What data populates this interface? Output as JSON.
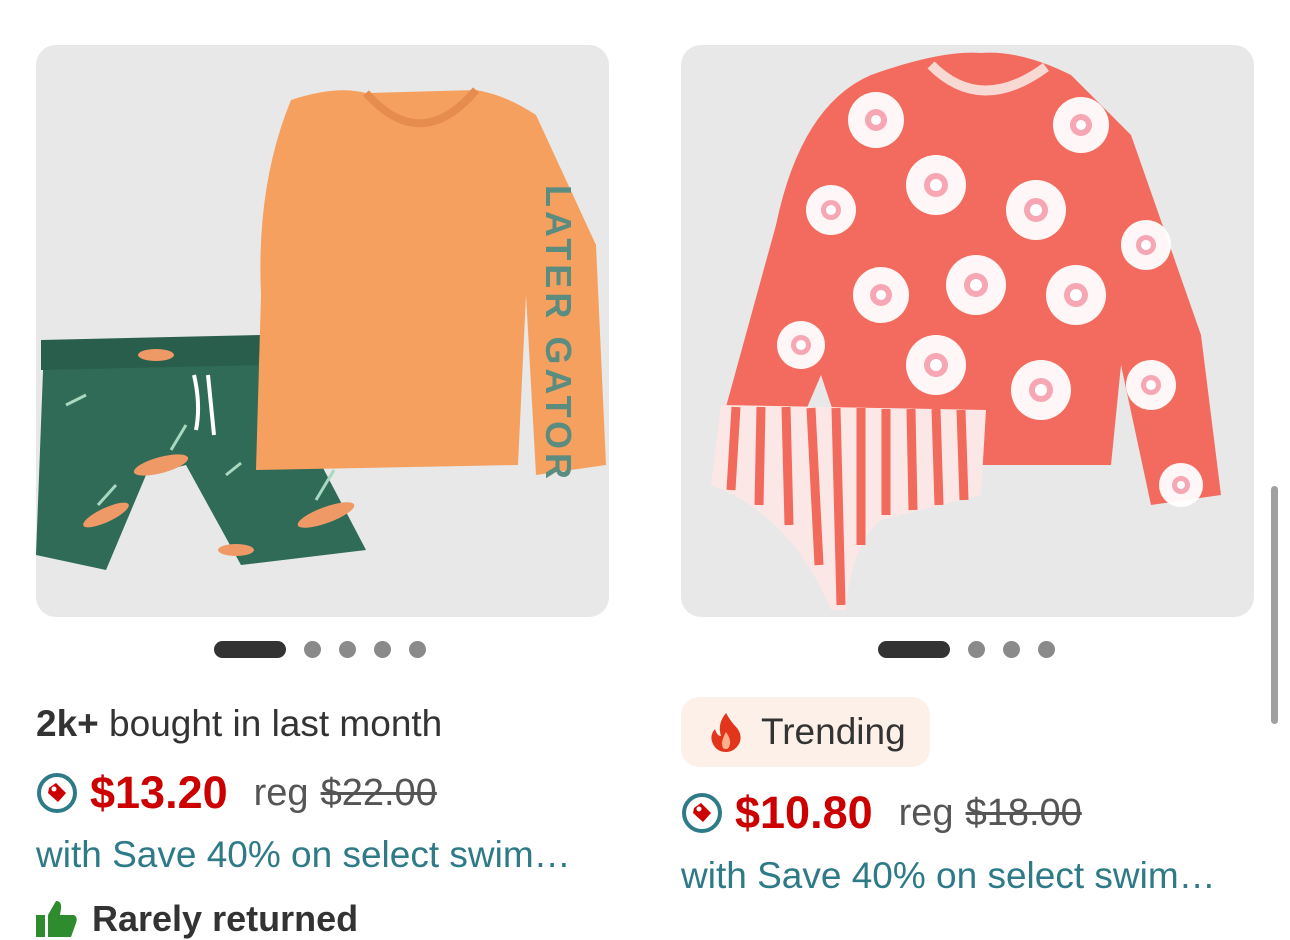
{
  "products": [
    {
      "image_alt": "Toddler boys orange rash guard and green alligator swim trunks set",
      "carousel": {
        "total": 5,
        "active": 1
      },
      "social_proof": {
        "bold": "2k+",
        "text": "bought in last month"
      },
      "price": {
        "icon": "target-circle-tag-icon",
        "sale": "$13.20",
        "reg_label": "reg",
        "reg_value": "$22.00"
      },
      "promo": "with Save 40% on select swim…",
      "returns": {
        "icon": "thumbs-up-icon",
        "label": "Rarely returned"
      }
    },
    {
      "image_alt": "Toddler girls coral daisy rash guard and striped swim bottom set",
      "carousel": {
        "total": 4,
        "active": 1
      },
      "badge": {
        "icon": "fire-icon",
        "label": "Trending"
      },
      "price": {
        "icon": "target-circle-tag-icon",
        "sale": "$10.80",
        "reg_label": "reg",
        "reg_value": "$18.00"
      },
      "promo": "with Save 40% on select swim…"
    }
  ],
  "colors": {
    "sale_price": "#cc0000",
    "promo_text": "#2e7a87",
    "badge_bg": "#fdf0e8",
    "image_bg": "#e8e8e8",
    "icon_teal": "#2e7a87",
    "fire": "#e2361c",
    "thumb": "#2e8b2e"
  }
}
